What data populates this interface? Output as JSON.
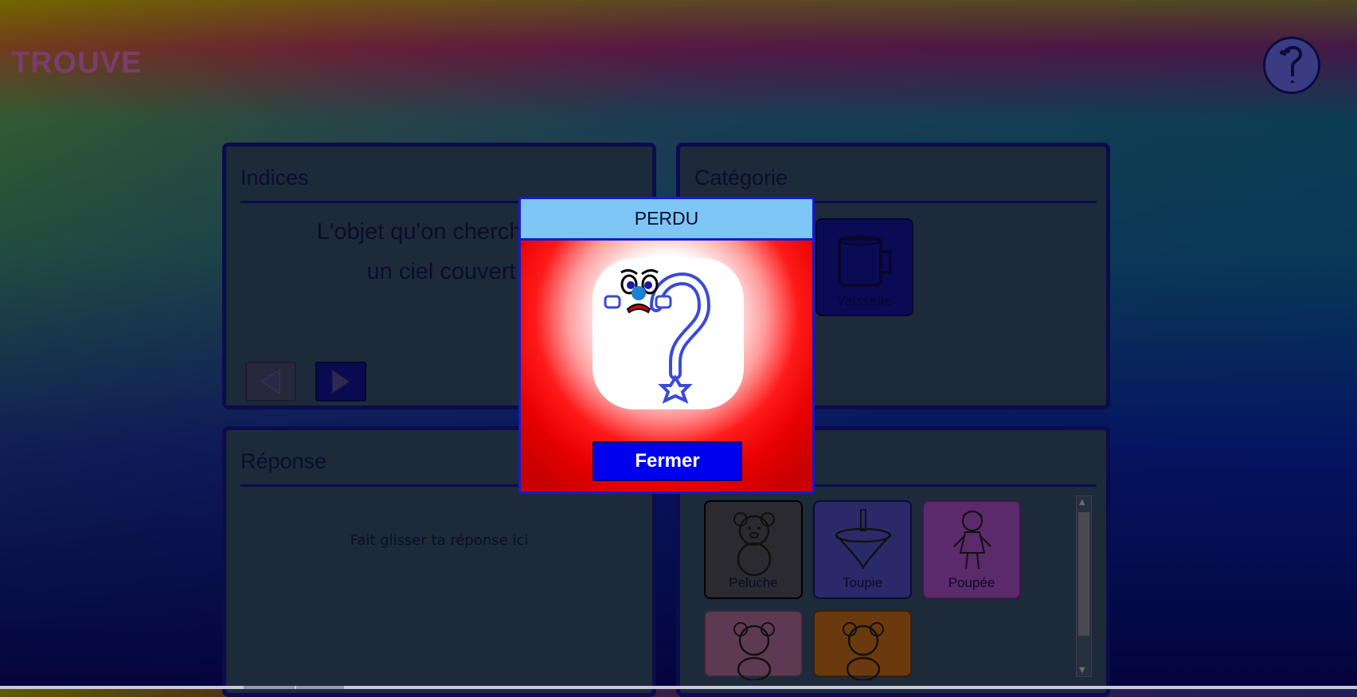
{
  "app": {
    "title": "TROUVE"
  },
  "help": {
    "icon": "question-mascot-icon"
  },
  "indices": {
    "title": "Indices",
    "hint_line1": "L'objet qu'on cherche fai",
    "hint_line2": "un ciel couvert",
    "prev_icon": "arrow-left-icon",
    "next_icon": "arrow-right-icon"
  },
  "categorie": {
    "title": "Catégorie",
    "card_label": "Vaisselle",
    "card_icon": "mug-icon"
  },
  "reponse": {
    "title": "Réponse",
    "drop_hint": "Fait glisser ta réponse ici"
  },
  "objets": {
    "items": [
      {
        "label": "Peluche",
        "icon": "teddy-bear-icon",
        "color": "#2a2a30"
      },
      {
        "label": "Toupie",
        "icon": "spinning-top-icon",
        "color": "#2a2a6a"
      },
      {
        "label": "Poupée",
        "icon": "doll-icon",
        "color": "#5a2a6a"
      },
      {
        "label": "",
        "icon": "teddy-bear-icon",
        "color": "#5e3a52"
      },
      {
        "label": "",
        "icon": "teddy-bear-icon",
        "color": "#6a3a0e"
      }
    ]
  },
  "modal": {
    "title": "PERDU",
    "close_label": "Fermer",
    "image_icon": "sad-question-mascot-icon",
    "colors": {
      "header": "#7ec6f6",
      "button": "#0000ee",
      "background": "#e60000"
    }
  }
}
